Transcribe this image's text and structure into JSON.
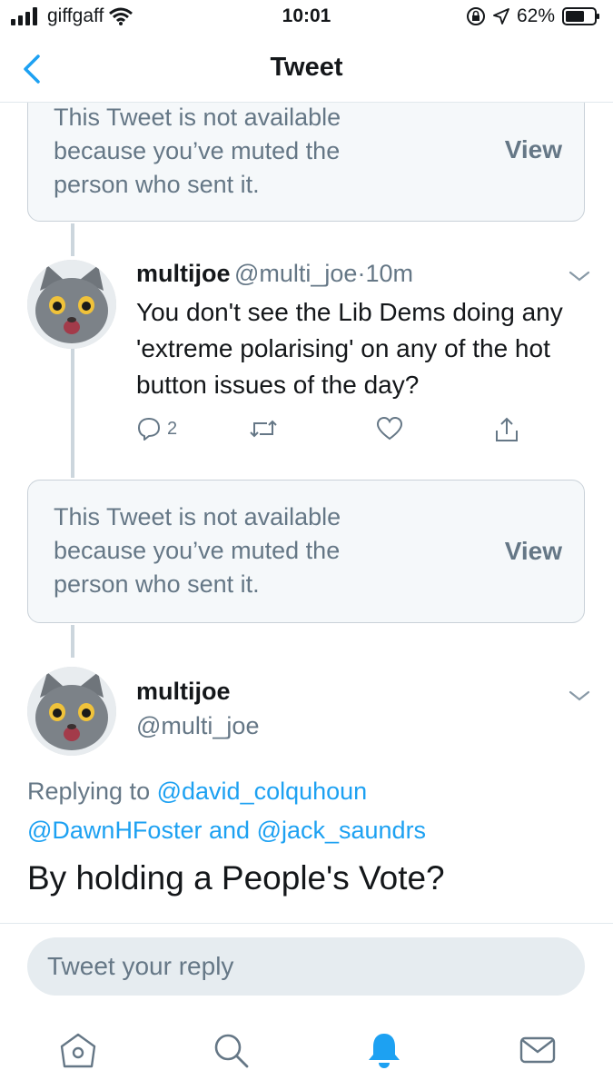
{
  "status_bar": {
    "carrier": "giffgaff",
    "time": "10:01",
    "battery": "62%"
  },
  "nav": {
    "title": "Tweet"
  },
  "muted_notice": {
    "text": "This Tweet is not available because you’ve muted the person who sent it.",
    "view_label": "View"
  },
  "tweet1": {
    "name": "multijoe",
    "handle": "@multi_joe",
    "separator": "·",
    "time": "10m",
    "text": "You don't see the Lib Dems doing any 'extreme polarising' on any of the hot button issues of the day?",
    "reply_count": "2"
  },
  "tweet2": {
    "name": "multijoe",
    "handle": "@multi_joe",
    "replying_prefix": "Replying to",
    "mention1": "@david_colquhoun",
    "mention2": "@DawnHFoster",
    "and_word": "and",
    "mention3": "@jack_saundrs",
    "text": "By holding a People's Vote?"
  },
  "reply_box": {
    "placeholder": "Tweet your reply"
  },
  "colors": {
    "accent": "#1da1f2",
    "muted_text": "#657786",
    "card_bg": "#f5f8fa",
    "card_border": "#c9d1d8"
  },
  "icons": [
    "signal-icon",
    "wifi-icon",
    "lock-rotation-icon",
    "location-icon",
    "battery-icon",
    "back-chevron-icon",
    "chevron-down-icon",
    "reply-icon",
    "retweet-icon",
    "like-icon",
    "share-icon",
    "home-icon",
    "search-icon",
    "notifications-icon",
    "messages-icon"
  ]
}
